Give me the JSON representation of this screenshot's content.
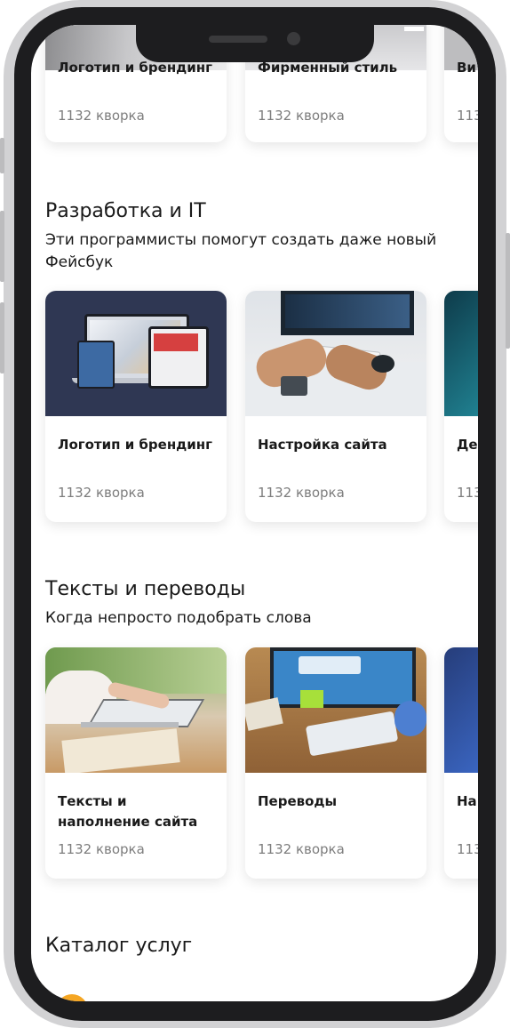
{
  "sections": [
    {
      "cards": [
        {
          "title": "Логотип и брендинг",
          "count": "1132 кворка"
        },
        {
          "title": "Фирменный стиль",
          "count": "1132 кворка"
        },
        {
          "title": "Ви",
          "count": "113"
        }
      ]
    },
    {
      "title": "Разработка и IT",
      "subtitle": "Эти программисты помогут создать даже новый Фейсбук",
      "cards": [
        {
          "title": "Логотип и брендинг",
          "count": "1132 кворка"
        },
        {
          "title": "Настройка сайта",
          "count": "1132 кворка"
        },
        {
          "title": "Де про",
          "count": "113"
        }
      ]
    },
    {
      "title": "Тексты и переводы",
      "subtitle": "Когда непросто подобрать слова",
      "cards": [
        {
          "title": "Тексты и наполнение сайта",
          "count": "1132 кворка"
        },
        {
          "title": "Переводы",
          "count": "1132 кворка"
        },
        {
          "title": "На",
          "count": "113"
        }
      ]
    }
  ],
  "catalog": {
    "title": "Каталог услуг"
  }
}
